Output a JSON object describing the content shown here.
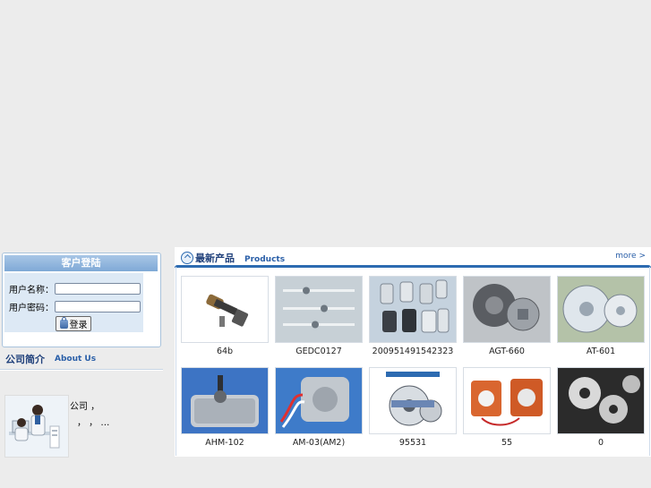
{
  "login": {
    "title": "客户登陆",
    "username_label": "用户名称：",
    "password_label": "用户密码：",
    "username_value": "",
    "password_value": "",
    "submit_label": "登录"
  },
  "about": {
    "title_cn": "公司简介",
    "title_en": "About Us",
    "text_line1": "公司            ，",
    "text_line2": "，     ，     …"
  },
  "products": {
    "title_cn": "最新产品",
    "title_en": "Products",
    "more_label": "more >",
    "items": [
      {
        "name": "64b"
      },
      {
        "name": "GEDC0127"
      },
      {
        "name": "200951491542323"
      },
      {
        "name": "AGT-660"
      },
      {
        "name": "AT-601"
      },
      {
        "name": "AHM-102"
      },
      {
        "name": "AM-03(AM2)"
      },
      {
        "name": "95531"
      },
      {
        "name": "55"
      },
      {
        "name": "0"
      }
    ]
  },
  "colors": {
    "accent": "#2d6bb1",
    "header_gradient_top": "#a8c6e6",
    "page_bg": "#ececec"
  }
}
